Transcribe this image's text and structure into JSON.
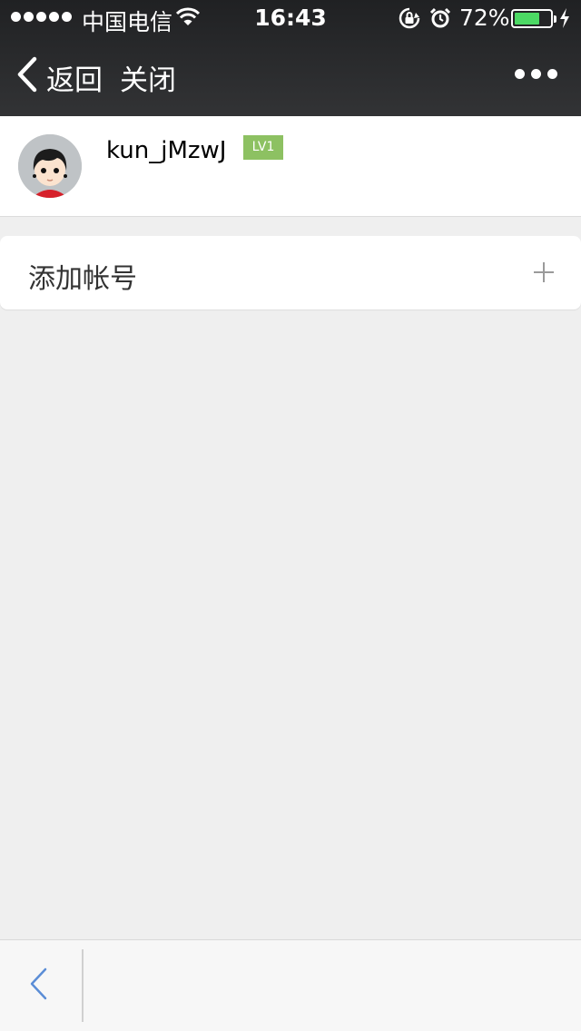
{
  "status_bar": {
    "carrier": "中国电信",
    "time": "16:43",
    "battery_percent": "72%",
    "battery_level": 0.72,
    "battery_color": "#4cd964"
  },
  "nav": {
    "back_label": "返回",
    "close_label": "关闭"
  },
  "account": {
    "username": "kun_jMzwJ",
    "level": "LV1",
    "level_color": "#8dc162"
  },
  "add_account": {
    "label": "添加帐号"
  },
  "icons": [
    "signal-dots",
    "wifi-icon",
    "rotation-lock-icon",
    "alarm-icon",
    "battery-icon",
    "charging-bolt-icon",
    "back-chevron-icon",
    "more-icon",
    "plus-icon"
  ]
}
